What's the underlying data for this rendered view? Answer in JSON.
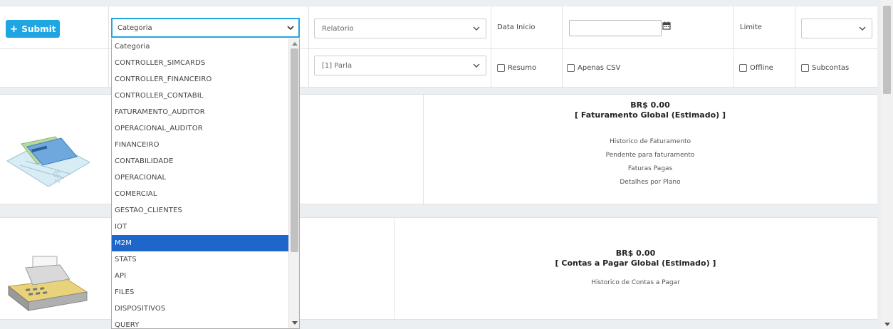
{
  "toolbar": {
    "submit_label": "Submit",
    "categoria_value": "Categoria",
    "relatorio_value": "Relatorio",
    "data_inicio_label": "Data Inicio",
    "data_inicio_value": "",
    "limite_label": "Limite",
    "limite_value": "",
    "parla_value": "[1] Parla",
    "resumo_label": "Resumo",
    "apenas_csv_label": "Apenas CSV",
    "offline_label": "Offline",
    "subcontas_label": "Subcontas"
  },
  "cards": [
    {
      "amount": "BR$ 0.00",
      "caption": "[ Faturamento Global (Estimado) ]",
      "links": [
        "Historico de Faturamento",
        "Pendente para faturamento",
        "Faturas Pagas",
        "Detalhes por Plano"
      ],
      "image": "check-payment-icon"
    },
    {
      "amount": "BR$ 0.00",
      "caption": "[ Contas a Pagar Global (Estimado) ]",
      "links": [
        "Historico de Contas a Pagar"
      ],
      "image": "cash-register-icon"
    }
  ],
  "dropdown": {
    "items": [
      "Categoria",
      "CONTROLLER_SIMCARDS",
      "CONTROLLER_FINANCEIRO",
      "CONTROLLER_CONTABIL",
      "FATURAMENTO_AUDITOR",
      "OPERACIONAL_AUDITOR",
      "FINANCEIRO",
      "CONTABILIDADE",
      "OPERACIONAL",
      "COMERCIAL",
      "GESTAO_CLIENTES",
      "IOT",
      "M2M",
      "STATS",
      "API",
      "FILES",
      "DISPOSITIVOS",
      "QUERY"
    ],
    "selected": "M2M"
  },
  "colors": {
    "accent": "#1ea6e2",
    "selected": "#1e66c9"
  }
}
